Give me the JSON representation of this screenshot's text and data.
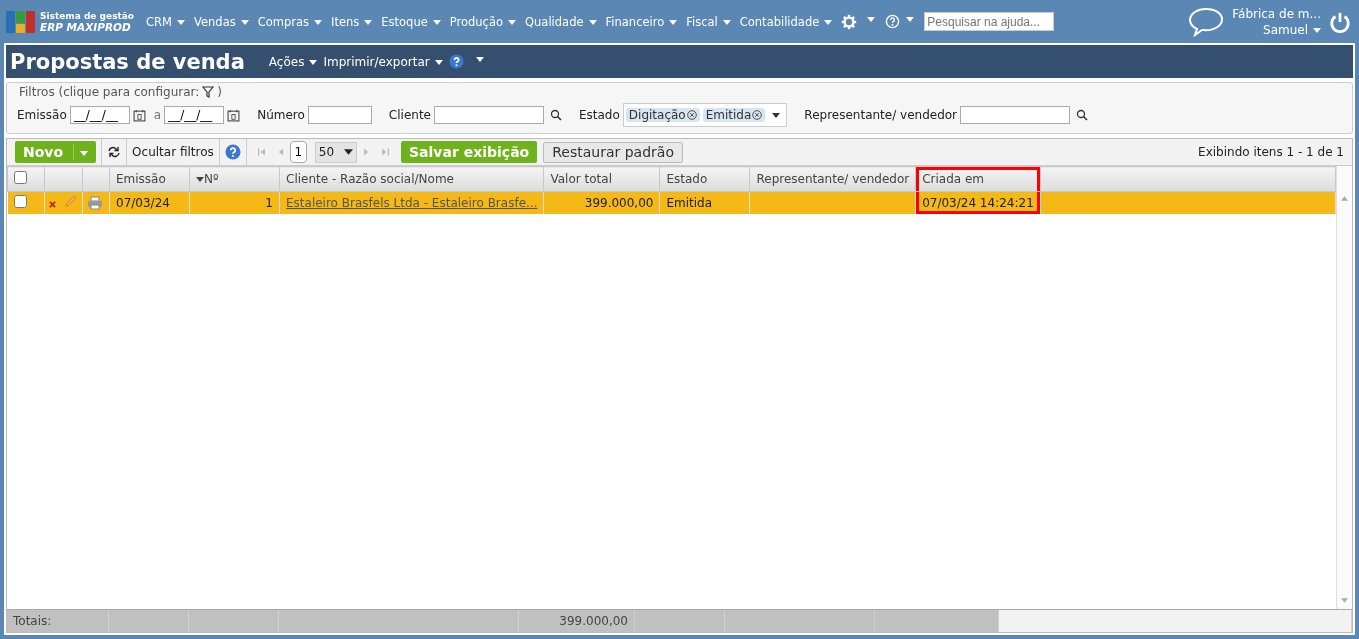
{
  "app": {
    "brand_top": "Sistema de gestão",
    "brand_bottom": "ERP MAXIPROD"
  },
  "nav": [
    "CRM",
    "Vendas",
    "Compras",
    "Itens",
    "Estoque",
    "Produção",
    "Qualidade",
    "Financeiro",
    "Fiscal",
    "Contabilidade"
  ],
  "help_search": {
    "placeholder": "Pesquisar na ajuda..."
  },
  "account": {
    "company": "Fábrica de m...",
    "user": "Samuel"
  },
  "page": {
    "title": "Propostas de venda",
    "menus": [
      "Ações",
      "Imprimir/exportar"
    ]
  },
  "filters": {
    "legend": "Filtros (clique para configurar:",
    "close_paren": ")",
    "emission_label": "Emissão",
    "date_from": "__/__/__",
    "to_label": "a",
    "date_to": "__/__/__",
    "number_label": "Número",
    "client_label": "Cliente",
    "state_label": "Estado",
    "state_chips": [
      "Digitação",
      "Emitida"
    ],
    "rep_label": "Representante/ vendedor"
  },
  "toolbar": {
    "new_button": "Novo",
    "hide_filters": "Ocultar filtros",
    "page": "1",
    "page_size": "50",
    "save_view": "Salvar exibição",
    "restore_default": "Restaurar padrão",
    "showing": "Exibindo itens 1 - 1 de 1"
  },
  "table": {
    "all_checked": false
  },
  "columns": [
    {
      "label": "Emissão",
      "sorted": false,
      "highlighted": false
    },
    {
      "label": "Nº",
      "sorted": true,
      "highlighted": false
    },
    {
      "label": "Cliente - Razão social/Nome",
      "sorted": false,
      "highlighted": false
    },
    {
      "label": "Valor total",
      "sorted": false,
      "highlighted": false
    },
    {
      "label": "Estado",
      "sorted": false,
      "highlighted": false
    },
    {
      "label": "Representante/ vendedor",
      "sorted": false,
      "highlighted": false
    },
    {
      "label": "Criada em",
      "sorted": false,
      "highlighted": true
    }
  ],
  "rows": [
    {
      "selected": true,
      "checked": false,
      "emission": "07/03/24",
      "number": "1",
      "client": "Estaleiro Brasfels Ltda - Estaleiro Brasfe...",
      "total": "399.000,00",
      "state": "Emitida",
      "rep": "",
      "created": "07/03/24 14:24:21"
    }
  ],
  "totals": {
    "label": "Totais:",
    "total": "399.000,00"
  }
}
